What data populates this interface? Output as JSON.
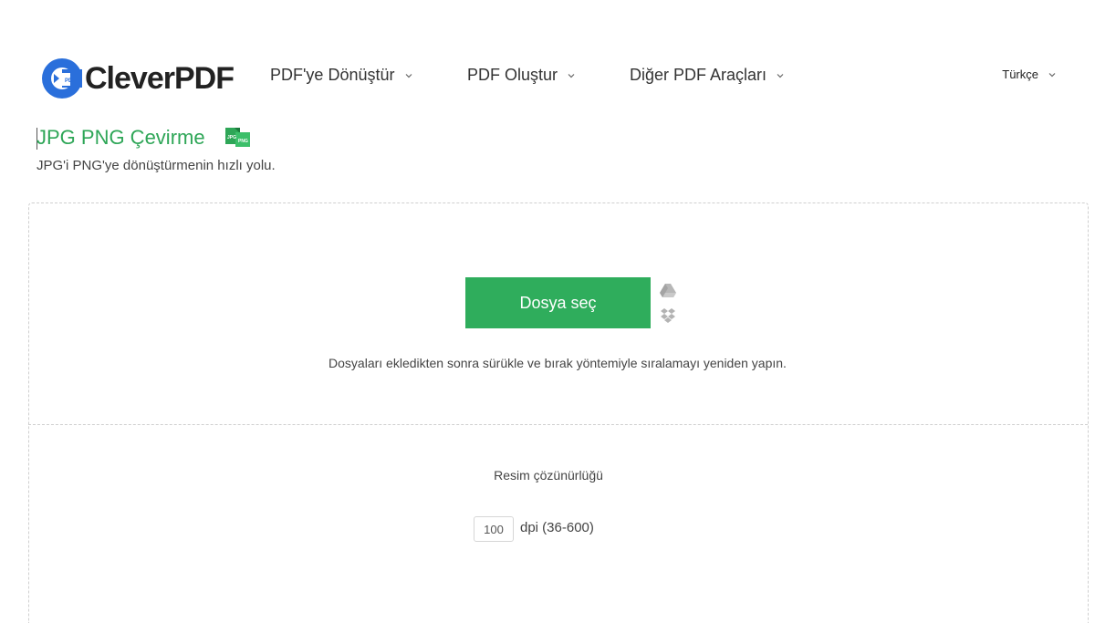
{
  "header": {
    "logo_text": "CleverPDF",
    "logo_badge": "PDF",
    "nav": [
      {
        "label": "PDF'ye Dönüştür"
      },
      {
        "label": "PDF Oluştur"
      },
      {
        "label": "Diğer PDF Araçları"
      }
    ],
    "language": "Türkçe"
  },
  "page": {
    "title": "JPG PNG Çevirme",
    "title_icon_labels": [
      "JPG",
      "PNG"
    ],
    "subtitle": "JPG'i PNG'ye dönüştürmenin hızlı yolu."
  },
  "upload": {
    "button_label": "Dosya seç",
    "cloud_icons": [
      "google-drive-icon",
      "dropbox-icon"
    ],
    "hint": "Dosyaları ekledikten sonra sürükle ve bırak yöntemiyle sıralamayı yeniden yapın."
  },
  "options": {
    "resolution_label": "Resim çözünürlüğü",
    "dpi_value": "100",
    "dpi_unit": "dpi (36-600)"
  },
  "colors": {
    "brand_blue": "#2a6fdb",
    "accent_green": "#2fad5c",
    "title_green": "#2ea657"
  }
}
